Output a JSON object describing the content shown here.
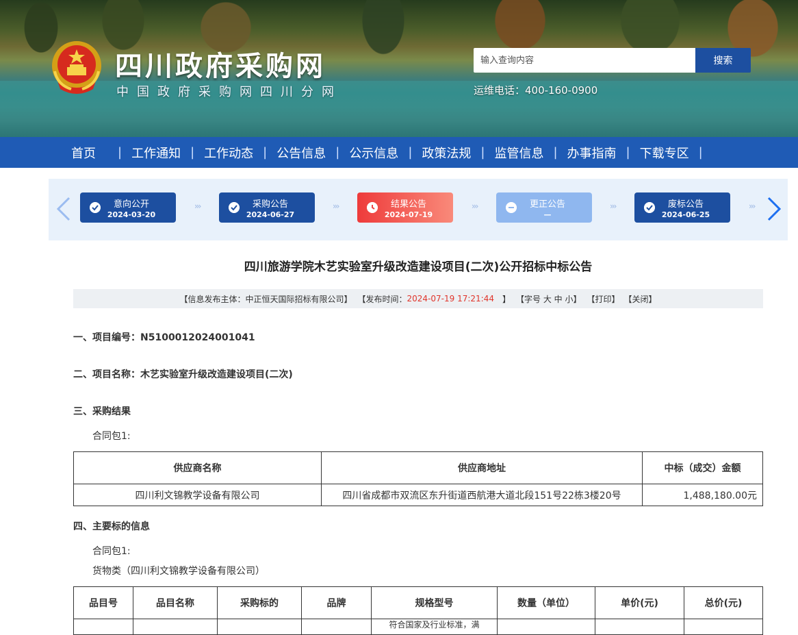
{
  "header": {
    "site_title": "四川政府采购网",
    "site_subtitle": "中国政府采购网四川分网",
    "search_placeholder": "输入查询内容",
    "search_button": "搜索",
    "hotline": "运维电话：400-160-0900"
  },
  "nav": {
    "items": [
      {
        "label": "首页"
      },
      {
        "label": "工作通知"
      },
      {
        "label": "工作动态"
      },
      {
        "label": "公告信息"
      },
      {
        "label": "公示信息"
      },
      {
        "label": "政策法规"
      },
      {
        "label": "监管信息"
      },
      {
        "label": "办事指南"
      },
      {
        "label": "下载专区"
      }
    ]
  },
  "timeline": {
    "steps": [
      {
        "name": "意向公开",
        "date": "2024-03-20",
        "color": "#1d4fa0",
        "icon": "check-icon"
      },
      {
        "name": "采购公告",
        "date": "2024-06-27",
        "color": "#1d4fa0",
        "icon": "check-icon"
      },
      {
        "name": "结果公告",
        "date": "2024-07-19",
        "color": "#ef4444",
        "icon": "clock-icon"
      },
      {
        "name": "更正公告",
        "date": "—",
        "color": "#8fb7ef",
        "icon": "minus-icon"
      },
      {
        "name": "废标公告",
        "date": "2024-06-25",
        "color": "#1d4fa0",
        "icon": "check-icon"
      }
    ]
  },
  "article": {
    "title": "四川旅游学院木艺实验室升级改造建设项目(二次)公开招标中标公告",
    "info": {
      "publisher": "【信息发布主体：中正恒天国际招标有限公司】",
      "time_label": "【发布时间：",
      "time_value": "2024-07-19 17:21:44",
      "time_close": "】",
      "font_size": "【字号 大 中 小】",
      "print": "【打印】",
      "close": "【关闭】"
    },
    "sec1": "一、项目编号：N5100012024001041",
    "sec2": "二、项目名称：木艺实验室升级改造建设项目(二次)",
    "sec3": "三、采购结果",
    "sec3_package": "合同包1:",
    "result_table": {
      "headers": [
        "供应商名称",
        "供应商地址",
        "中标（成交）金额"
      ],
      "rows": [
        [
          "四川利文锦教学设备有限公司",
          "四川省成都市双流区东升街道西航港大道北段151号22栋3楼20号",
          "1,488,180.00元"
        ]
      ]
    },
    "sec4": "四、主要标的信息",
    "sec4_package": "合同包1:",
    "sec4_goods": "货物类（四川利文锦教学设备有限公司）",
    "goods_table": {
      "headers": [
        "品目号",
        "品目名称",
        "采购标的",
        "品牌",
        "规格型号",
        "数量（单位）",
        "单价(元)",
        "总价(元)"
      ],
      "partial_text": "符合国家及行业标准，满"
    }
  }
}
